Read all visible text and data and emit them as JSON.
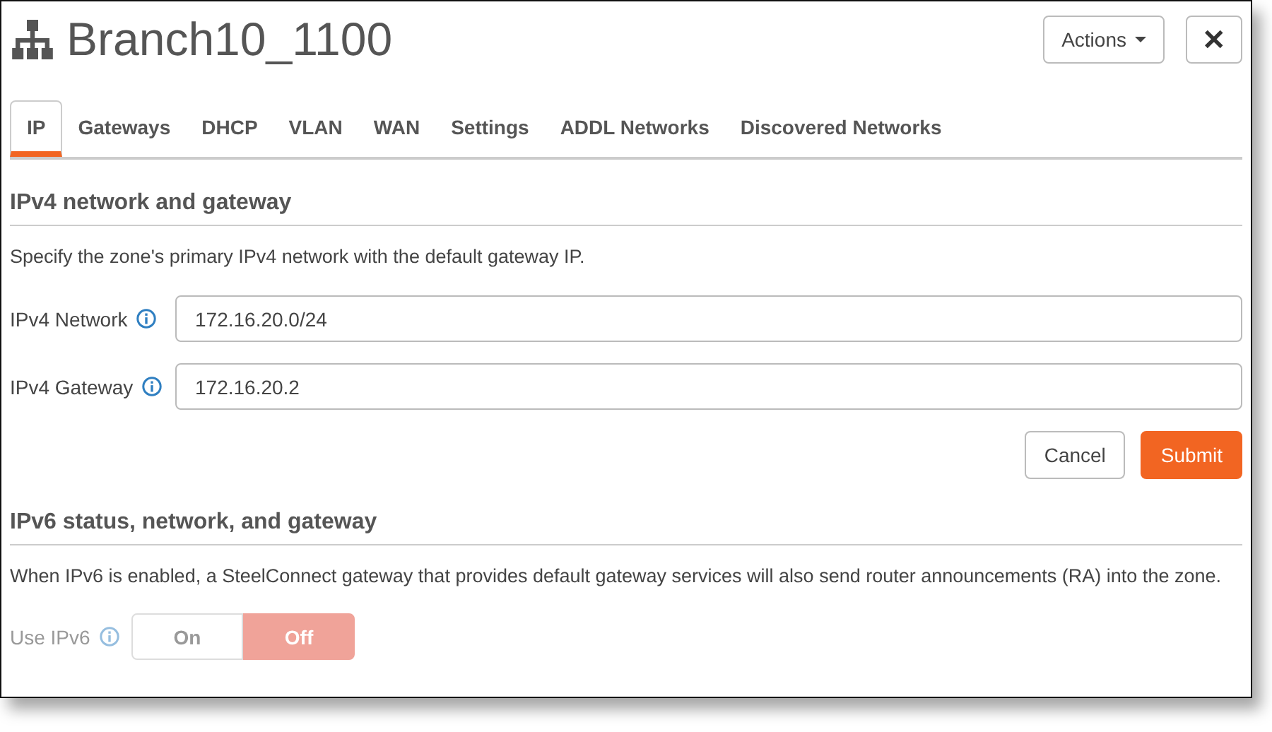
{
  "window": {
    "title": "Branch10_1100"
  },
  "header_buttons": [
    {
      "label": "Actions",
      "kind": "dropdown"
    },
    {
      "label": "✕",
      "kind": "close"
    }
  ],
  "tabs": [
    {
      "label": "IP",
      "selected": true
    },
    {
      "label": "Gateways",
      "selected": false
    },
    {
      "label": "DHCP",
      "selected": false
    },
    {
      "label": "VLAN",
      "selected": false
    },
    {
      "label": "WAN",
      "selected": false
    },
    {
      "label": "Settings",
      "selected": false
    },
    {
      "label": "ADDL Networks",
      "selected": false
    },
    {
      "label": "Discovered Networks",
      "selected": false
    }
  ],
  "ipv4": {
    "heading": "IPv4 network and gateway",
    "description": "Specify the zone's primary IPv4 network with the default gateway IP.",
    "fields": [
      {
        "label": "IPv4 Network",
        "value": "172.16.20.0/24"
      },
      {
        "label": "IPv4 Gateway",
        "value": "172.16.20.2"
      }
    ],
    "buttons": [
      {
        "label": "Cancel",
        "kind": "secondary"
      },
      {
        "label": "Submit",
        "kind": "primary"
      }
    ]
  },
  "ipv6": {
    "heading": "IPv6 status, network, and gateway",
    "description": "When IPv6 is enabled, a SteelConnect gateway that provides default gateway services will also send router announcements (RA) into the zone.",
    "toggle": {
      "label": "Use IPv6",
      "disabled": true,
      "options": [
        {
          "label": "On",
          "selected": false
        },
        {
          "label": "Off",
          "selected": true
        }
      ]
    }
  }
}
